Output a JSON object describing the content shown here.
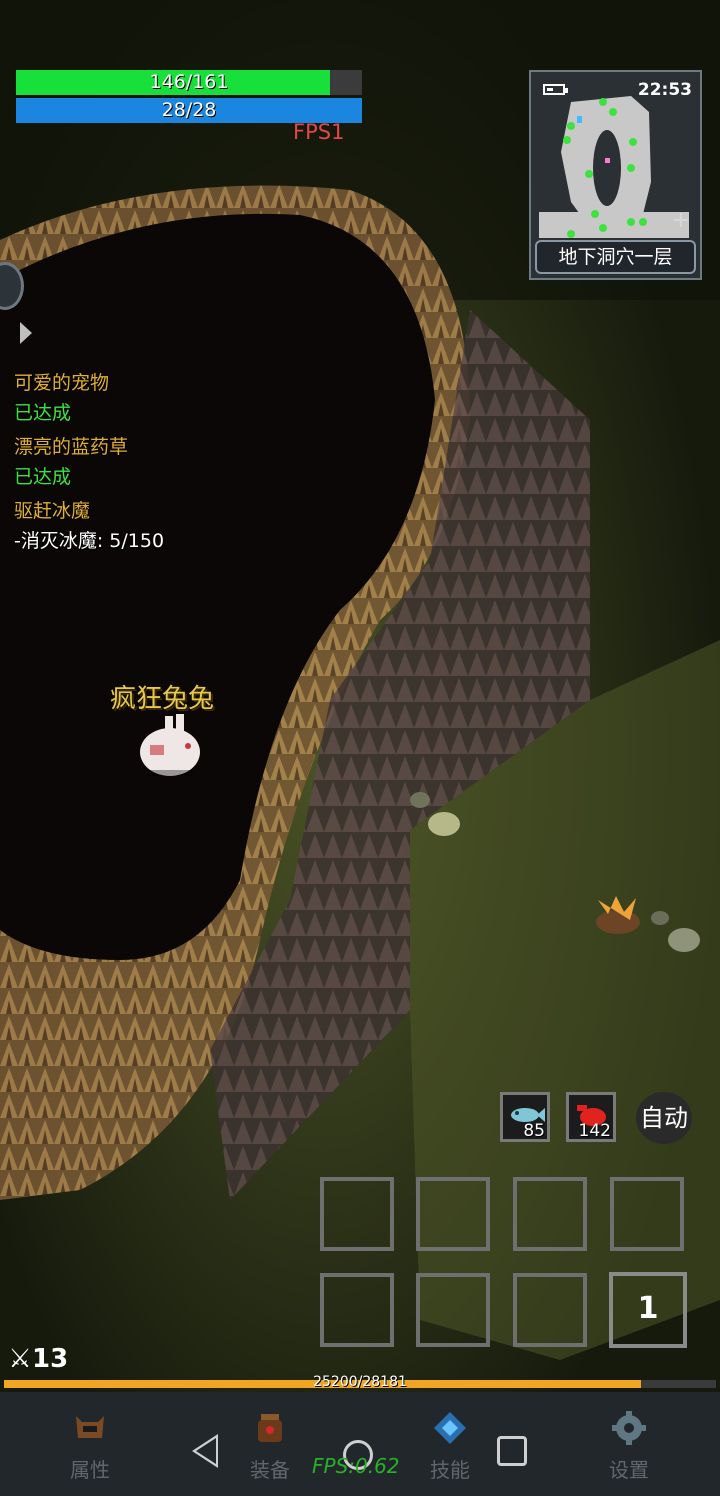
{
  "hud": {
    "hp": {
      "text": "146/161",
      "value": 146,
      "max": 161
    },
    "mp": {
      "text": "28/28",
      "value": 28,
      "max": 28
    },
    "fps_label": "FPS1"
  },
  "minimap": {
    "time": "22:53",
    "location": "地下洞穴一层"
  },
  "quests": [
    {
      "title": "可爱的宠物",
      "status": "已达成"
    },
    {
      "title": "漂亮的蓝药草",
      "status": "已达成"
    },
    {
      "title": "驱赶冰魔",
      "status": "-消灭冰魔: 5/150"
    }
  ],
  "mob": {
    "name": "疯狂兔兔"
  },
  "quick_items": [
    {
      "icon": "fish-icon",
      "count": "85"
    },
    {
      "icon": "red-potion-icon",
      "count": "142"
    }
  ],
  "auto_label": "自动",
  "skill_slot_number": "1",
  "attack": {
    "value": "13"
  },
  "exp": {
    "text": "25200/28181",
    "value": 25200,
    "max": 28181
  },
  "nav": [
    {
      "label": "属性",
      "icon": "helmet-icon"
    },
    {
      "label": "装备",
      "icon": "bag-icon"
    },
    {
      "label": "技能",
      "icon": "skill-gem-icon"
    },
    {
      "label": "设置",
      "icon": "gear-icon"
    }
  ],
  "fps_bottom": "FPS:0.62",
  "colors": {
    "hp": "#18e03a",
    "mp": "#1a86e0",
    "exp": "#f1a623",
    "quest_title": "#e0b032",
    "quest_done": "#3ee23e"
  }
}
